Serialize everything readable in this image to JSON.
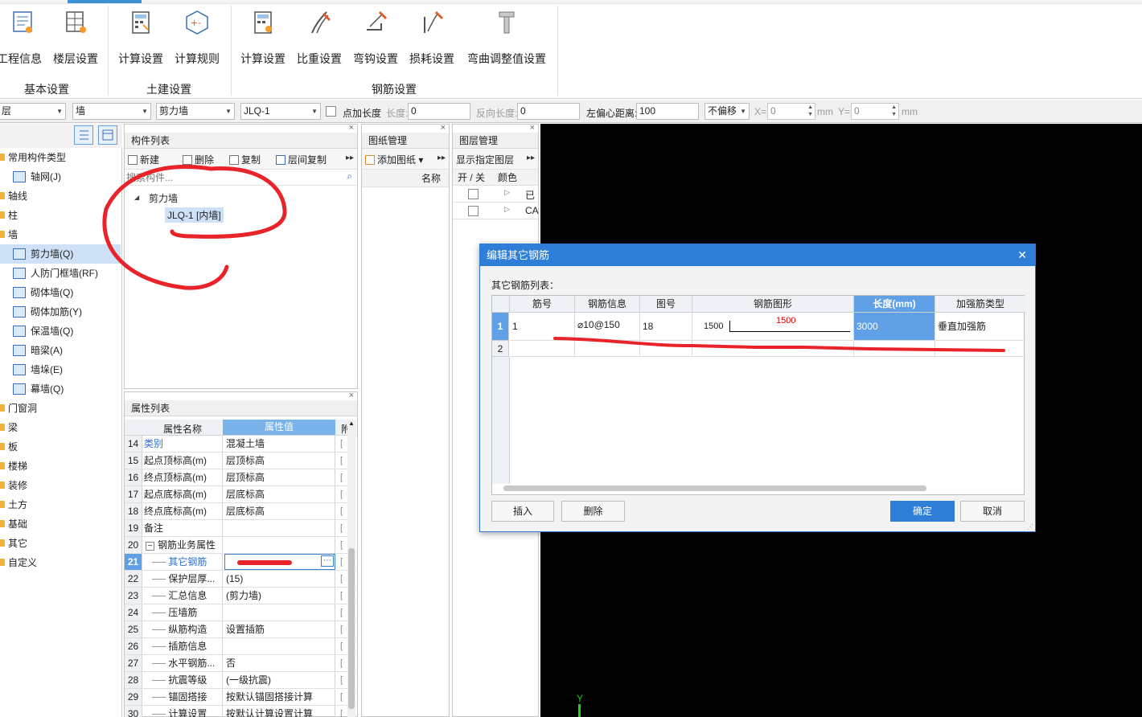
{
  "ribbon": {
    "groups": [
      {
        "label": "基本设置",
        "buttons": [
          "工程信息",
          "楼层设置"
        ]
      },
      {
        "label": "土建设置",
        "buttons": [
          "计算设置",
          "计算规则"
        ]
      },
      {
        "label": "钢筋设置",
        "buttons": [
          "计算设置",
          "比重设置",
          "弯钩设置",
          "损耗设置",
          "弯曲调整值设置"
        ]
      }
    ]
  },
  "toolbar": {
    "floor": "层",
    "category": "墙",
    "type": "剪力墙",
    "component": "JLQ-1",
    "point_length_label": "点加长度",
    "length_label": "长度:",
    "length_value": "0",
    "reverse_length_label": "反向长度:",
    "reverse_length_value": "0",
    "offset_label": "左偏心距离:",
    "offset_value": "100",
    "offset_mode": "不偏移",
    "x_label": "X=",
    "x_value": "0",
    "y_label": "Y=",
    "y_value": "0",
    "unit": "mm"
  },
  "nav": {
    "items": [
      {
        "label": "常用构件类型",
        "level": 0
      },
      {
        "label": "轴网(J)",
        "level": 1
      },
      {
        "label": "轴线",
        "level": 0
      },
      {
        "label": "柱",
        "level": 0
      },
      {
        "label": "墙",
        "level": 0
      },
      {
        "label": "剪力墙(Q)",
        "level": 1,
        "selected": true
      },
      {
        "label": "人防门框墙(RF)",
        "level": 1
      },
      {
        "label": "砌体墙(Q)",
        "level": 1
      },
      {
        "label": "砌体加筋(Y)",
        "level": 1
      },
      {
        "label": "保温墙(Q)",
        "level": 1
      },
      {
        "label": "暗梁(A)",
        "level": 1
      },
      {
        "label": "墙垛(E)",
        "level": 1
      },
      {
        "label": "幕墙(Q)",
        "level": 1
      },
      {
        "label": "门窗洞",
        "level": 0
      },
      {
        "label": "梁",
        "level": 0
      },
      {
        "label": "板",
        "level": 0
      },
      {
        "label": "楼梯",
        "level": 0
      },
      {
        "label": "装修",
        "level": 0
      },
      {
        "label": "土方",
        "level": 0
      },
      {
        "label": "基础",
        "level": 0
      },
      {
        "label": "其它",
        "level": 0
      },
      {
        "label": "自定义",
        "level": 0
      }
    ]
  },
  "component_list": {
    "title": "构件列表",
    "new": "新建",
    "delete": "删除",
    "copy": "复制",
    "floor_copy": "层间复制",
    "search_placeholder": "搜索构件...",
    "tree_root": "剪力墙",
    "tree_child": "JLQ-1 [内墙]"
  },
  "drawing": {
    "title": "图纸管理",
    "add": "添加图纸",
    "col_name": "名称"
  },
  "layer": {
    "title": "图层管理",
    "show": "显示指定图层",
    "col_toggle": "开 / 关",
    "col_color": "颜色",
    "rows": [
      "已",
      "CA"
    ]
  },
  "props": {
    "title": "属性列表",
    "col_name": "属性名称",
    "col_value": "属性值",
    "col_extra": "附",
    "rows": [
      {
        "no": "14",
        "name": "类别",
        "value": "混凝土墙",
        "blue": true
      },
      {
        "no": "15",
        "name": "起点顶标高(m)",
        "value": "层顶标高"
      },
      {
        "no": "16",
        "name": "终点顶标高(m)",
        "value": "层顶标高"
      },
      {
        "no": "17",
        "name": "起点底标高(m)",
        "value": "层底标高"
      },
      {
        "no": "18",
        "name": "终点底标高(m)",
        "value": "层底标高"
      },
      {
        "no": "19",
        "name": "备注",
        "value": ""
      },
      {
        "no": "20",
        "name": "钢筋业务属性",
        "value": "",
        "group": true
      },
      {
        "no": "21",
        "name": "其它钢筋",
        "value": "",
        "active": true
      },
      {
        "no": "22",
        "name": "保护层厚...",
        "value": "(15)"
      },
      {
        "no": "23",
        "name": "汇总信息",
        "value": "(剪力墙)"
      },
      {
        "no": "24",
        "name": "压墙筋",
        "value": ""
      },
      {
        "no": "25",
        "name": "纵筋构造",
        "value": "设置插筋"
      },
      {
        "no": "26",
        "name": "插筋信息",
        "value": ""
      },
      {
        "no": "27",
        "name": "水平钢筋...",
        "value": "否"
      },
      {
        "no": "28",
        "name": "抗震等级",
        "value": "(一级抗震)"
      },
      {
        "no": "29",
        "name": "锚固搭接",
        "value": "按默认锚固搭接计算"
      },
      {
        "no": "30",
        "name": "计算设置",
        "value": "按默认计算设置计算"
      }
    ]
  },
  "dialog": {
    "title": "编辑其它钢筋",
    "list_label": "其它钢筋列表：",
    "columns": [
      "筋号",
      "钢筋信息",
      "图号",
      "钢筋图形",
      "长度(mm)",
      "加强筋类型"
    ],
    "rows": [
      {
        "no": "1",
        "bar_no": "1",
        "bar_info": "⌀10@150",
        "fig_no": "18",
        "shape_left": "1500",
        "shape_top": "1500",
        "length": "3000",
        "type": "垂直加强筋"
      },
      {
        "no": "2",
        "bar_no": "",
        "bar_info": "",
        "fig_no": "",
        "shape_left": "",
        "shape_top": "",
        "length": "",
        "type": ""
      }
    ],
    "insert": "插入",
    "delete": "删除",
    "ok": "确定",
    "cancel": "取消"
  },
  "canvas": {
    "axis_label": "Y"
  }
}
